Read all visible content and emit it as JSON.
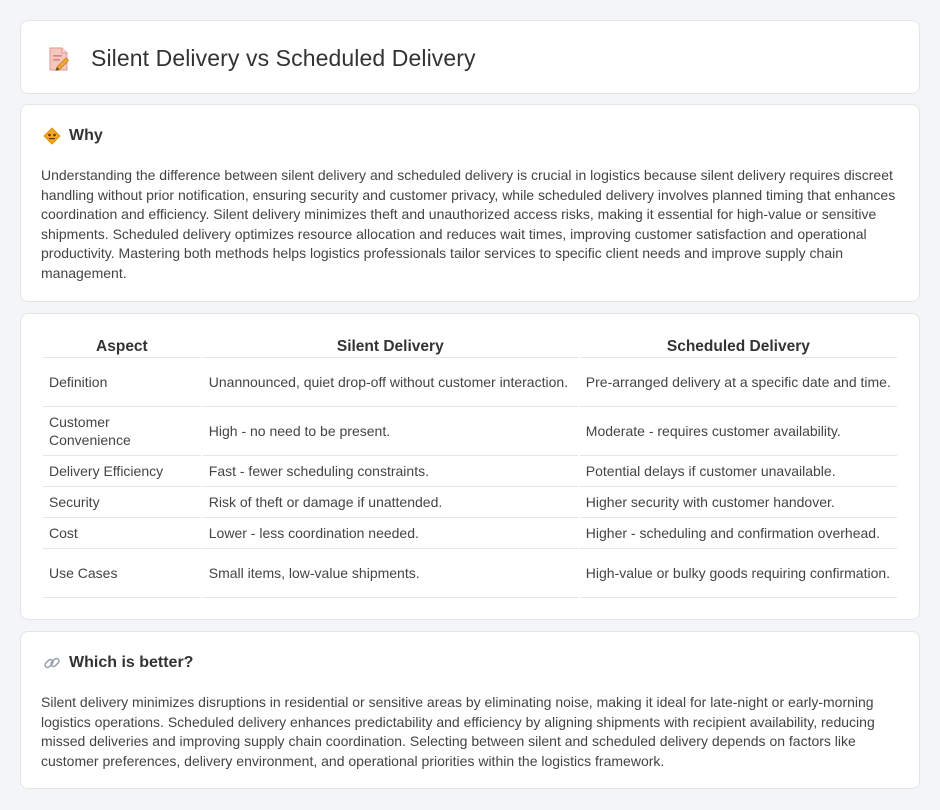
{
  "header": {
    "title": "Silent Delivery vs Scheduled Delivery",
    "icon": "document-pencil-icon"
  },
  "why": {
    "icon": "warning-sign-icon",
    "title": "Why",
    "text": "Understanding the difference between silent delivery and scheduled delivery is crucial in logistics because silent delivery requires discreet handling without prior notification, ensuring security and customer privacy, while scheduled delivery involves planned timing that enhances coordination and efficiency. Silent delivery minimizes theft and unauthorized access risks, making it essential for high-value or sensitive shipments. Scheduled delivery optimizes resource allocation and reduces wait times, improving customer satisfaction and operational productivity. Mastering both methods helps logistics professionals tailor services to specific client needs and improve supply chain management."
  },
  "table": {
    "headers": [
      "Aspect",
      "Silent Delivery",
      "Scheduled Delivery"
    ],
    "rows": [
      [
        "Definition",
        "Unannounced, quiet drop-off without customer interaction.",
        "Pre-arranged delivery at a specific date and time."
      ],
      [
        "Customer Convenience",
        "High - no need to be present.",
        "Moderate - requires customer availability."
      ],
      [
        "Delivery Efficiency",
        "Fast - fewer scheduling constraints.",
        "Potential delays if customer unavailable."
      ],
      [
        "Security",
        "Risk of theft or damage if unattended.",
        "Higher security with customer handover."
      ],
      [
        "Cost",
        "Lower - less coordination needed.",
        "Higher - scheduling and confirmation overhead."
      ],
      [
        "Use Cases",
        "Small items, low-value shipments.",
        "High-value or bulky goods requiring confirmation."
      ]
    ]
  },
  "better": {
    "icon": "link-icon",
    "title": "Which is better?",
    "text": "Silent delivery minimizes disruptions in residential or sensitive areas by eliminating noise, making it ideal for late-night or early-morning logistics operations. Scheduled delivery enhances predictability and efficiency by aligning shipments with recipient availability, reducing missed deliveries and improving supply chain coordination. Selecting between silent and scheduled delivery depends on factors like customer preferences, delivery environment, and operational priorities within the logistics framework."
  }
}
